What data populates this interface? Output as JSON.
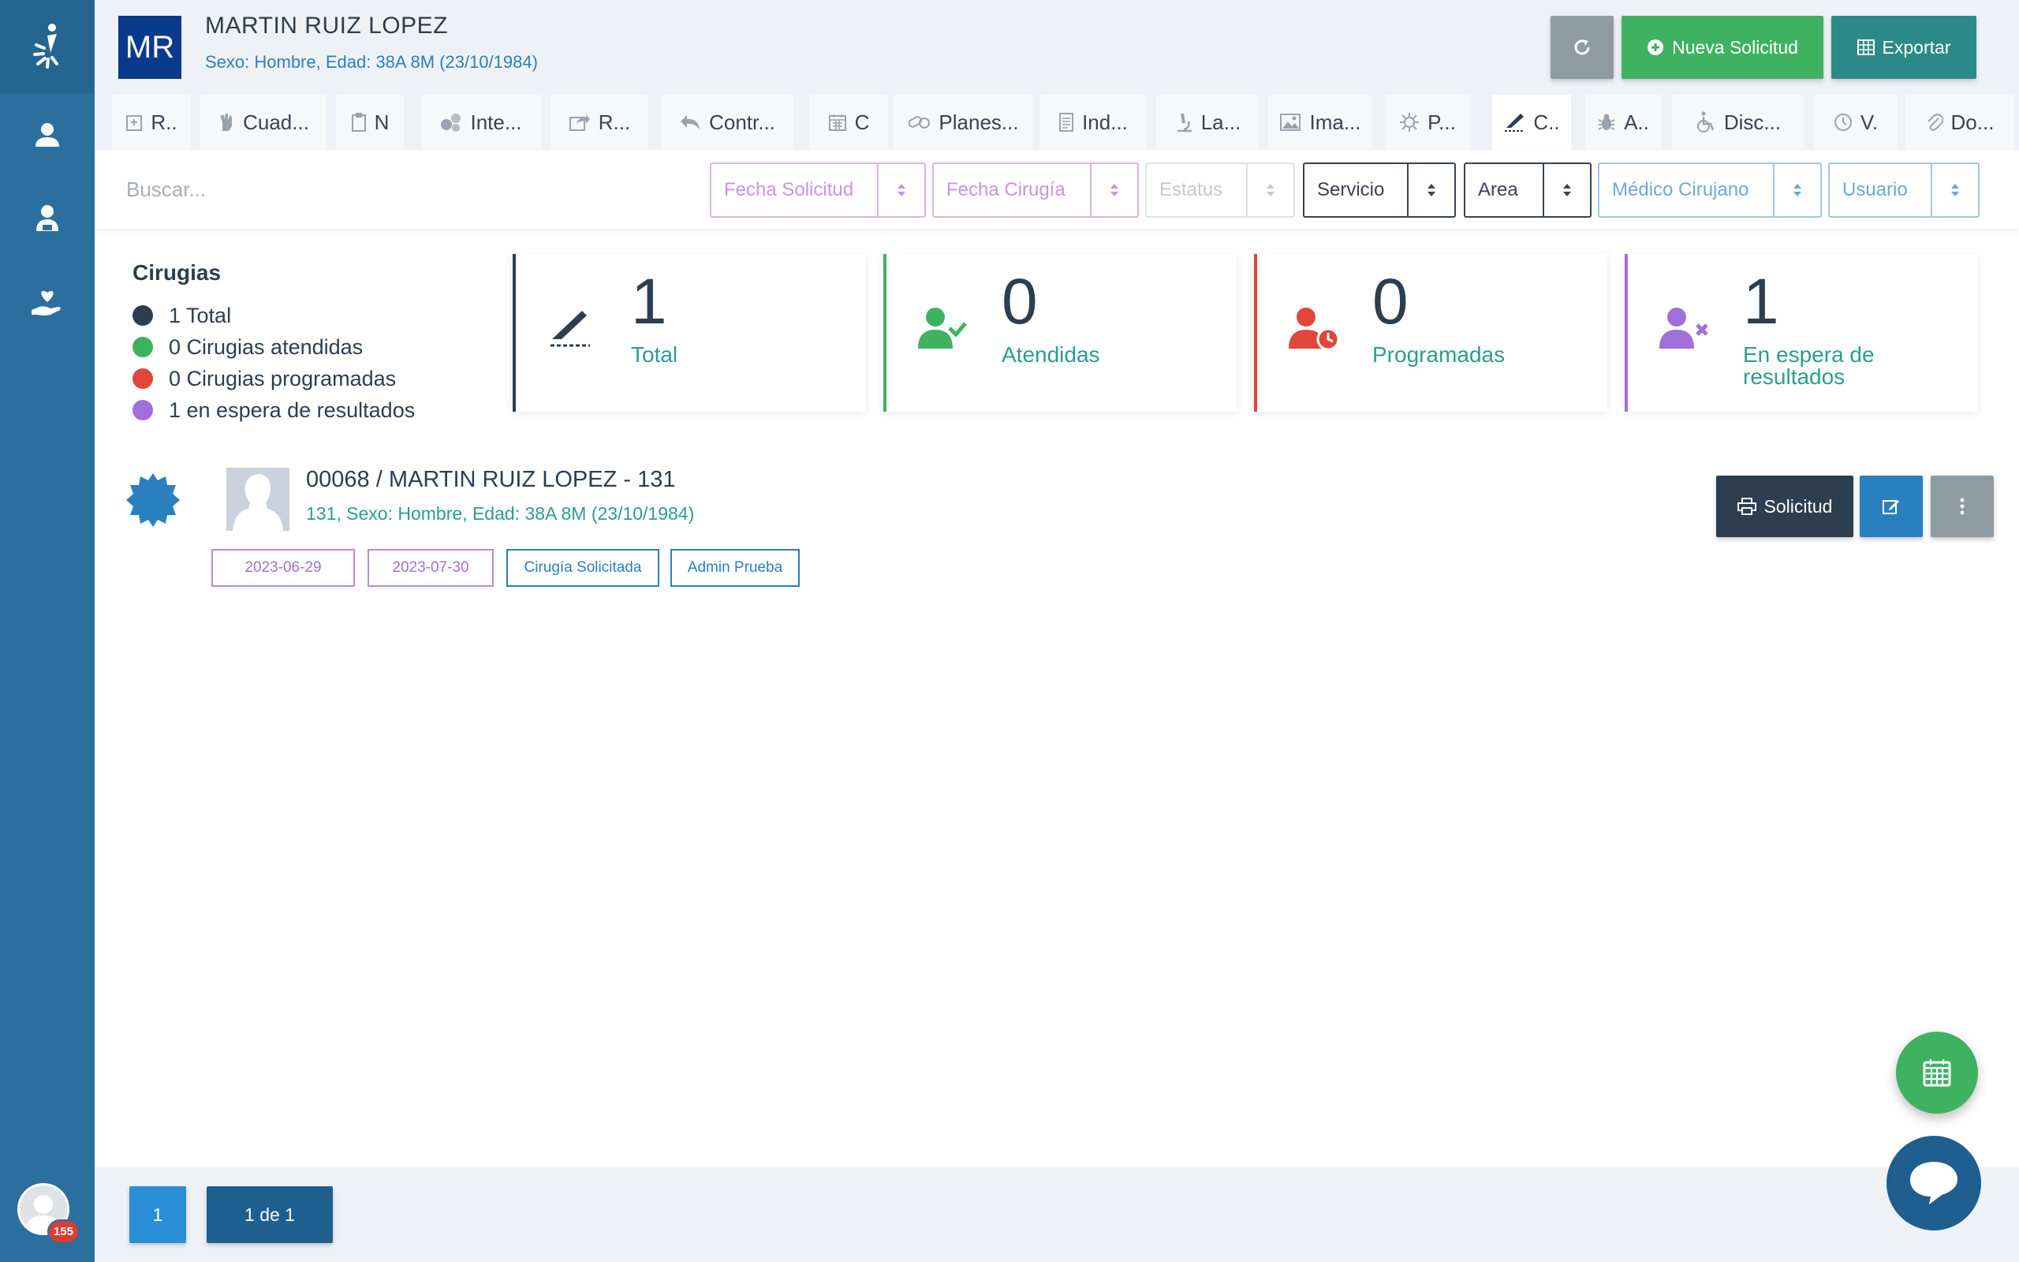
{
  "sidebar": {
    "items": [
      {
        "icon": "user-icon"
      },
      {
        "icon": "user-desk-icon"
      },
      {
        "icon": "hand-heart-icon"
      }
    ],
    "notification_count": "155"
  },
  "header": {
    "initials": "MR",
    "patient_name": "MARTIN RUIZ LOPEZ",
    "patient_info": "Sexo: Hombre, Edad: 38A 8M (23/10/1984)",
    "new_request_label": "Nueva Solicitud",
    "export_label": "Exportar"
  },
  "tabs": [
    {
      "label": "R..",
      "icon": "hospital-icon"
    },
    {
      "label": "Cuad...",
      "icon": "hand-icon"
    },
    {
      "label": "N",
      "icon": "clipboard-icon"
    },
    {
      "label": "Inte...",
      "icon": "circles-icon"
    },
    {
      "label": "R...",
      "icon": "share-icon"
    },
    {
      "label": "Contr...",
      "icon": "reply-icon"
    },
    {
      "label": "C",
      "icon": "calendar-icon"
    },
    {
      "label": "Planes...",
      "icon": "pills-icon"
    },
    {
      "label": "Ind...",
      "icon": "document-icon"
    },
    {
      "label": "La...",
      "icon": "microscope-icon"
    },
    {
      "label": "Ima...",
      "icon": "image-icon"
    },
    {
      "label": "P...",
      "icon": "virus-icon"
    },
    {
      "label": "C..",
      "icon": "scalpel-icon"
    },
    {
      "label": "A..",
      "icon": "bug-icon"
    },
    {
      "label": "Disc...",
      "icon": "wheelchair-icon"
    },
    {
      "label": "V.",
      "icon": "clock-icon"
    },
    {
      "label": "Do...",
      "icon": "paperclip-icon"
    }
  ],
  "filters": {
    "search_placeholder": "Buscar...",
    "fecha_solicitud": "Fecha Solicitud",
    "fecha_cirugia": "Fecha Cirugía",
    "estatus": "Estatus",
    "servicio": "Servicio",
    "area": "Area",
    "medico": "Médico Cirujano",
    "usuario": "Usuario"
  },
  "summary": {
    "title": "Cirugias",
    "legend": [
      {
        "text": "1 Total",
        "color": "#2c3e50"
      },
      {
        "text": "0 Cirugias atendidas",
        "color": "#3fb261"
      },
      {
        "text": "0 Cirugias programadas",
        "color": "#e2453b"
      },
      {
        "text": "1 en espera de resultados",
        "color": "#a06fd9"
      }
    ],
    "cards": [
      {
        "value": "1",
        "label": "Total",
        "color": "#2c3e50",
        "icon": "scalpel-icon"
      },
      {
        "value": "0",
        "label": "Atendidas",
        "color": "#3fb261",
        "icon": "user-check-icon"
      },
      {
        "value": "0",
        "label": "Programadas",
        "color": "#e2453b",
        "icon": "user-clock-icon"
      },
      {
        "value": "1",
        "label": "En espera de resultados",
        "color": "#a06fd9",
        "icon": "user-times-icon"
      }
    ]
  },
  "record": {
    "title": "00068 / MARTIN RUIZ LOPEZ - 131",
    "subtitle": "131, Sexo: Hombre, Edad: 38A 8M (23/10/1984)",
    "tags": {
      "fecha_solicitud": "2023-06-29",
      "fecha_cirugia": "2023-07-30",
      "estatus": "Cirugía Solicitada",
      "usuario": "Admin Prueba"
    },
    "print_label": "Solicitud"
  },
  "pagination": {
    "current": "1",
    "summary": "1 de 1"
  }
}
